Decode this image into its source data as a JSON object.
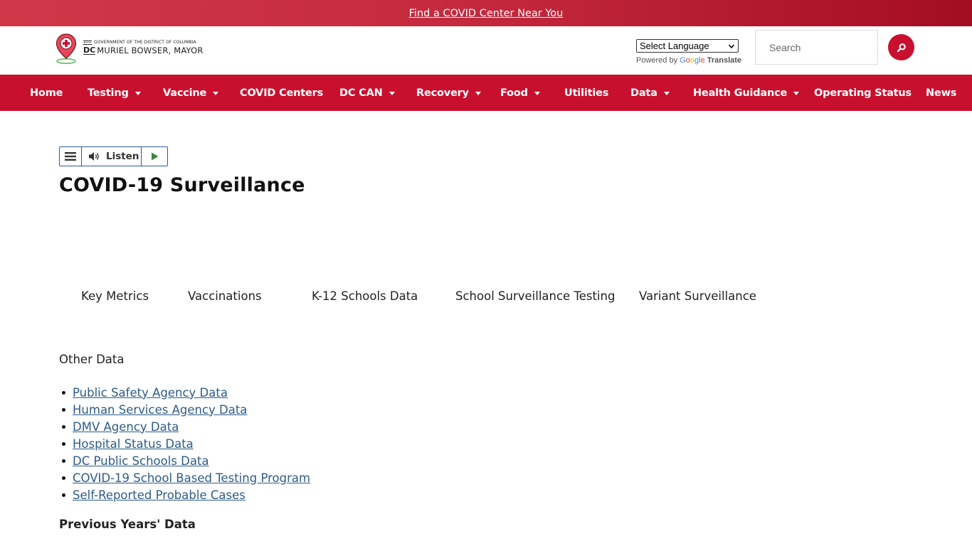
{
  "banner": {
    "link_text": "Find a COVID Center Near You"
  },
  "header": {
    "logo": {
      "government_line": "GOVERNMENT OF THE DISTRICT OF COLUMBIA",
      "dc_mark": "DC",
      "mayor_line": "MURIEL BOWSER, MAYOR"
    },
    "language_select": {
      "selected": "Select Language"
    },
    "translate_credit": {
      "powered_by": "Powered by",
      "google": "Google",
      "translate": "Translate"
    },
    "search": {
      "placeholder": "Search"
    }
  },
  "nav": {
    "items": [
      {
        "label": "Home",
        "dropdown": false
      },
      {
        "label": "Testing",
        "dropdown": true
      },
      {
        "label": "Vaccine",
        "dropdown": true
      },
      {
        "label": "COVID Centers",
        "dropdown": false
      },
      {
        "label": "DC CAN",
        "dropdown": true
      },
      {
        "label": "Recovery",
        "dropdown": true
      },
      {
        "label": "Food",
        "dropdown": true
      },
      {
        "label": "Utilities",
        "dropdown": false
      },
      {
        "label": "Data",
        "dropdown": true
      },
      {
        "label": "Health Guidance",
        "dropdown": true
      },
      {
        "label": "Operating Status",
        "dropdown": false
      },
      {
        "label": "News",
        "dropdown": false
      }
    ]
  },
  "listen_widget": {
    "label": "Listen"
  },
  "page": {
    "title": "COVID-19 Surveillance",
    "tabs": [
      "Key Metrics",
      "Vaccinations",
      "K-12 Schools Data",
      "School Surveillance Testing",
      "Variant Surveillance"
    ],
    "other_data_heading": "Other Data",
    "other_data_links": [
      "Public Safety Agency Data",
      "Human Services Agency Data",
      "DMV Agency Data",
      "Hospital Status Data",
      "DC Public Schools Data",
      "COVID-19 School Based Testing Program",
      "Self-Reported Probable Cases"
    ],
    "previous_years_heading": "Previous Years' Data"
  },
  "colors": {
    "brand_red": "#c8102e",
    "link_blue": "#2d5b8a"
  }
}
